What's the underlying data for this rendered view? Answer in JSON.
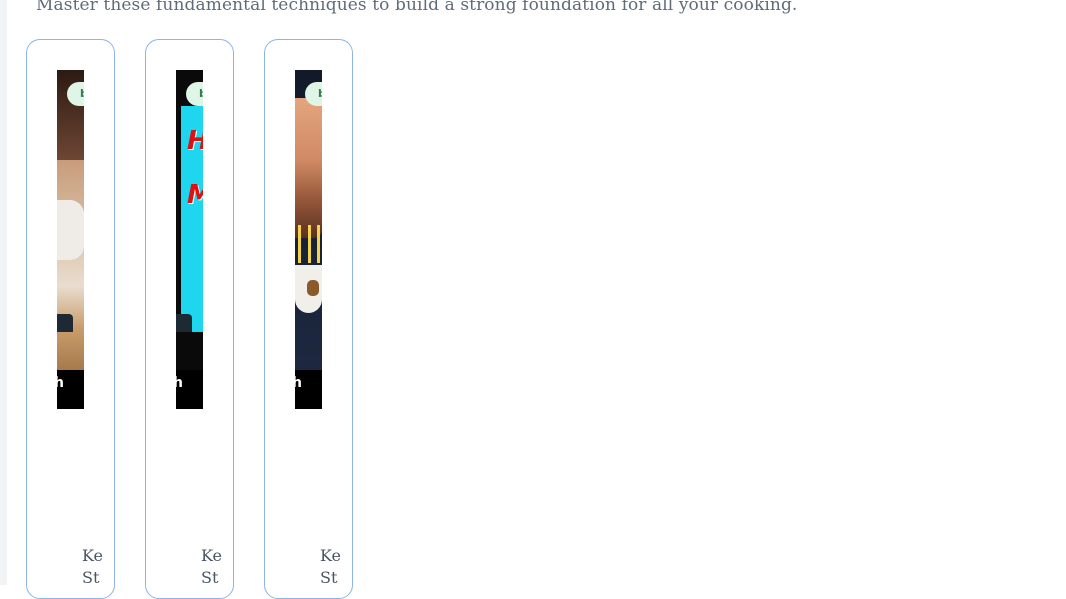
{
  "header": {
    "subtitle": "Master these fundamental techniques to build a strong foundation for all your cooking."
  },
  "cards": [
    {
      "badge": "b",
      "thumbnail_caption": "h",
      "author_line1": "Ke",
      "author_line2": "St"
    },
    {
      "badge": "b",
      "thumbnail_caption": "h",
      "thumbnail_text_line1": "H",
      "thumbnail_text_line2": "M",
      "author_line1": "Ke",
      "author_line2": "St"
    },
    {
      "badge": "b",
      "thumbnail_caption": "h",
      "author_line1": "Ke",
      "author_line2": "St"
    }
  ],
  "colors": {
    "card_border": "#8db4e6",
    "badge_bg": "#dff5e6",
    "badge_text": "#2f7d4a",
    "subtitle_text": "#5f6b7a"
  }
}
